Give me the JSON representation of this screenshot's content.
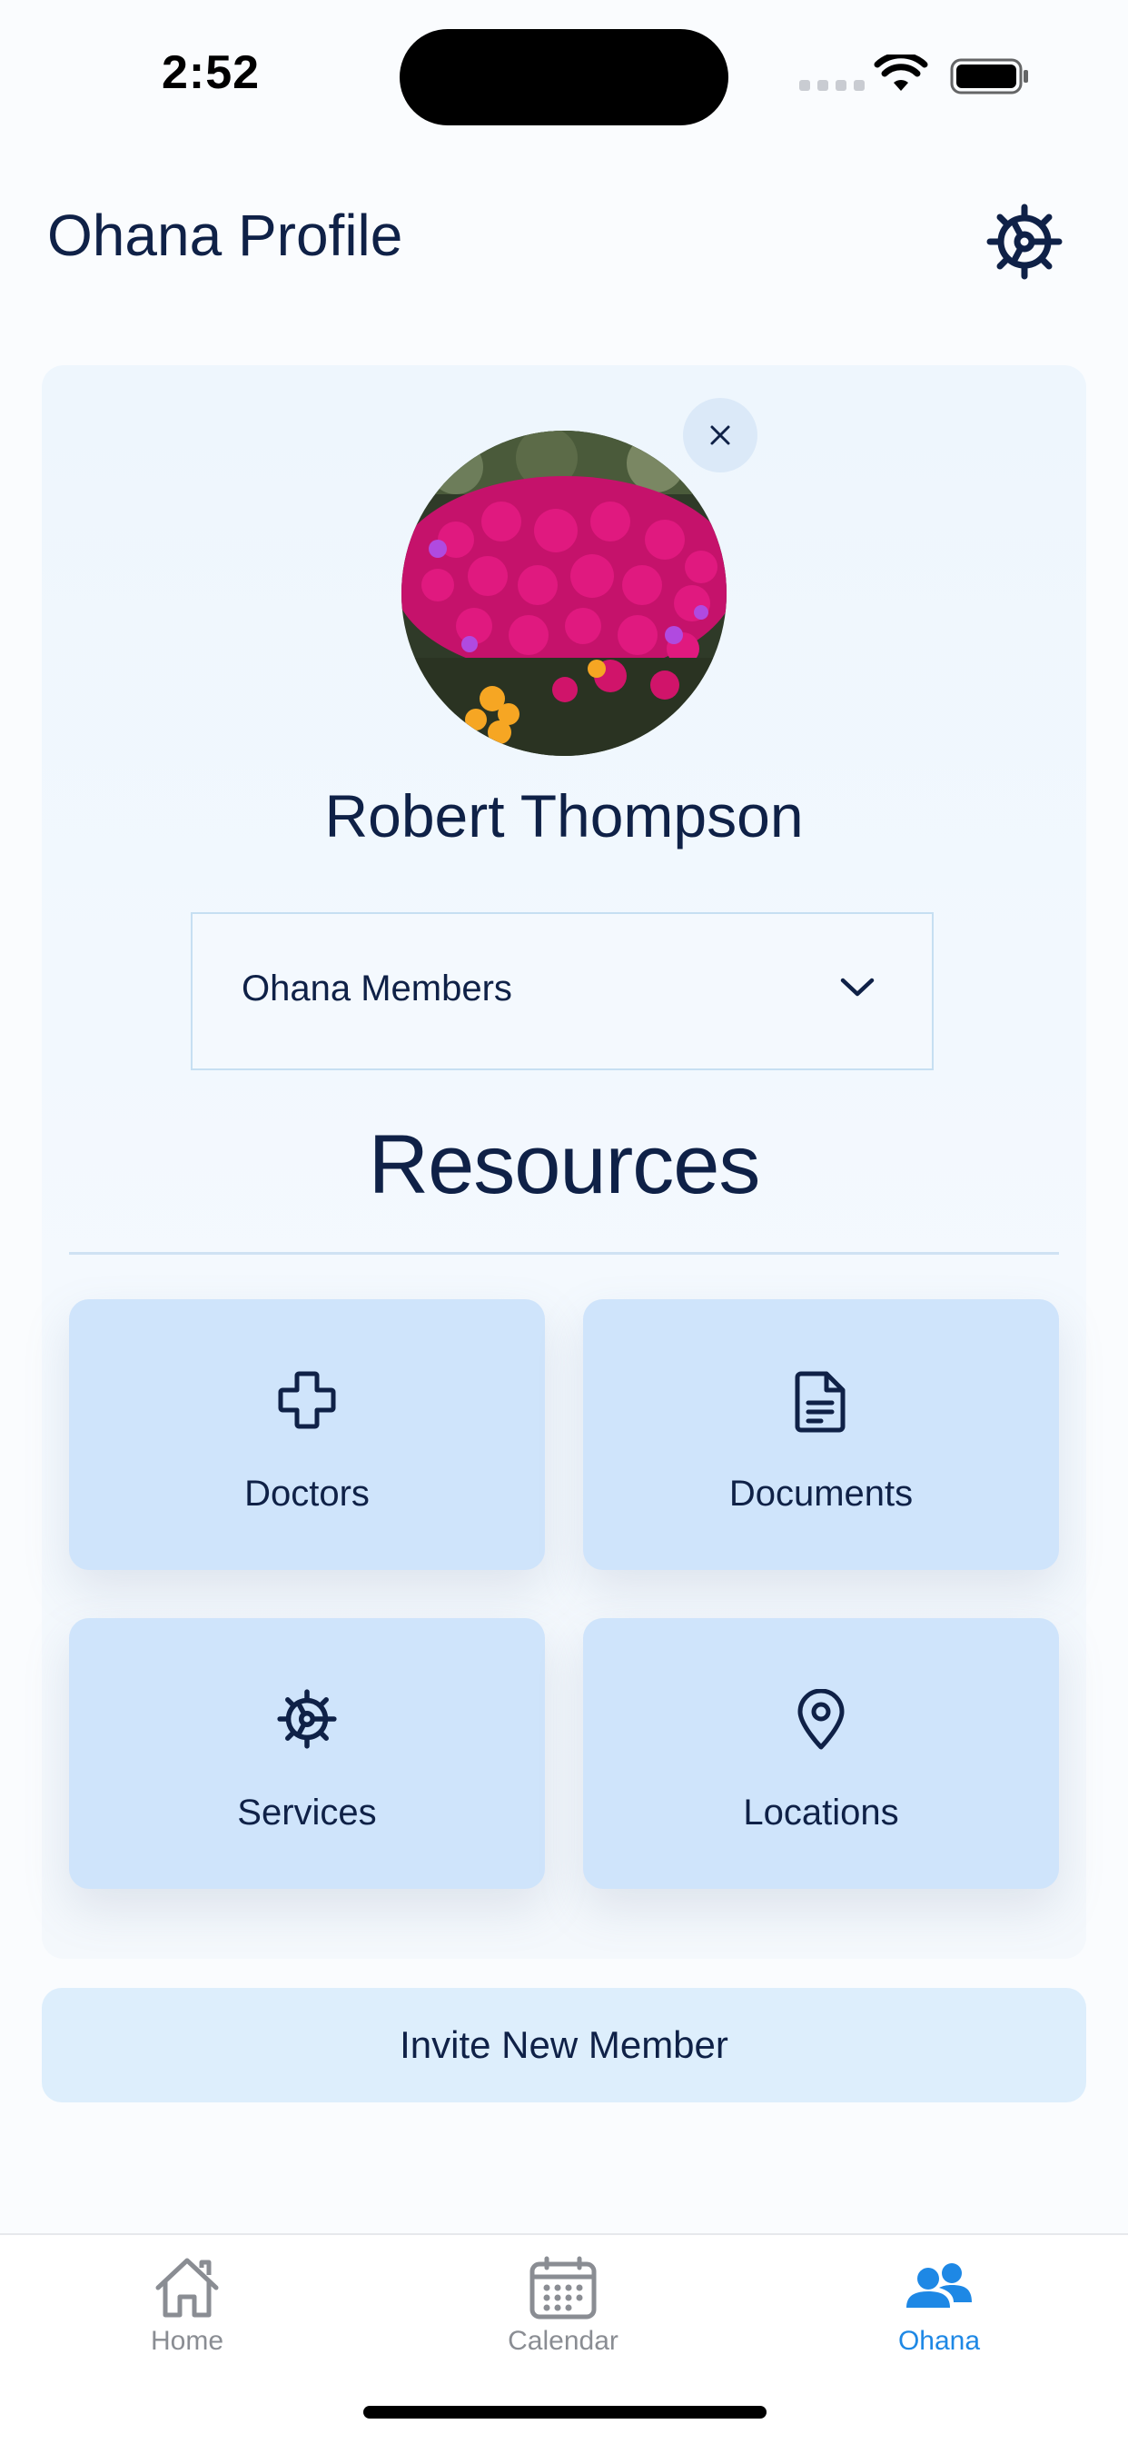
{
  "status_bar": {
    "time": "2:52"
  },
  "header": {
    "title": "Ohana Profile",
    "settings_icon": "gear-icon"
  },
  "profile": {
    "name": "Robert Thompson",
    "avatar": "flower-photo",
    "remove_icon": "close-icon"
  },
  "members_select": {
    "selected": "Ohana Members"
  },
  "resources": {
    "title": "Resources",
    "items": [
      {
        "label": "Doctors",
        "icon": "plus-cross-icon"
      },
      {
        "label": "Documents",
        "icon": "document-icon"
      },
      {
        "label": "Services",
        "icon": "gear-icon"
      },
      {
        "label": "Locations",
        "icon": "map-pin-icon"
      }
    ]
  },
  "invite": {
    "label": "Invite New Member"
  },
  "tab_bar": {
    "tabs": [
      {
        "label": "Home",
        "icon": "home-icon",
        "active": false
      },
      {
        "label": "Calendar",
        "icon": "calendar-icon",
        "active": false
      },
      {
        "label": "Ohana",
        "icon": "people-icon",
        "active": true
      }
    ]
  },
  "colors": {
    "text_primary": "#0f2147",
    "tile_bg": "#cfe4fb",
    "tab_active": "#1e88e5",
    "tab_inactive": "#8a8d93"
  }
}
